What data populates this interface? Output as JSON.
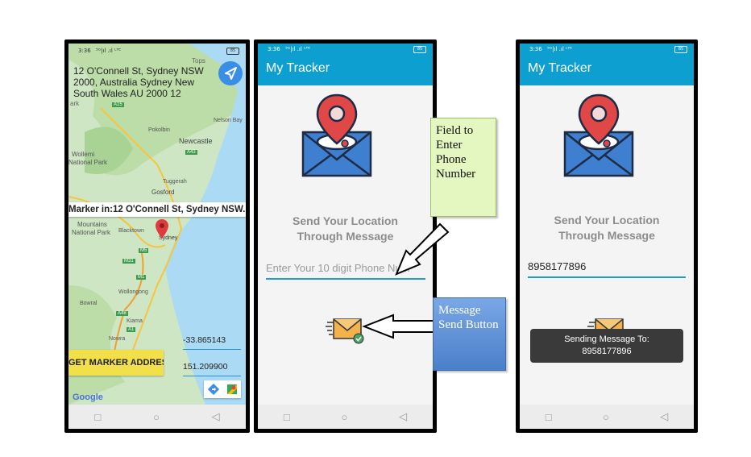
{
  "phone1": {
    "status_time": "3:36",
    "status_signal": "⁵ᴳ|ıl .ıl ᴸᵀᴱ",
    "battery": "85",
    "address": "12 O'Connell St, Sydney NSW 2000, Australia Sydney New South Wales AU 2000 12",
    "marker_info": "Marker in:12 O'Connell St, Sydney NSW...",
    "map_labels": [
      "Tops",
      "Park",
      "Nelson Bay",
      "Pokolbin",
      "Newcastle",
      "Wollemi",
      "National Park",
      "Tuggerah",
      "Gosford",
      "Mountains",
      "National Park",
      "Blacktown",
      "Sydney",
      "Wollongong",
      "Bowral",
      "Kiama",
      "Nowra",
      "A15",
      "A43",
      "M1",
      "M5",
      "M31",
      "A48",
      "A1",
      "ark"
    ],
    "latitude": "-33.865143",
    "longitude": "151.209900",
    "get_marker_button": "GET MARKER ADDRESS",
    "google_logo": "Google",
    "nav_icons": [
      "□",
      "○",
      "◁"
    ]
  },
  "phone2": {
    "status_time": "3:36",
    "status_signal": "⁵ᴳ|ıl .ıl ᴸᵀᴱ",
    "battery": "85",
    "app_title": "My Tracker",
    "heading_line1": "Send Your Location",
    "heading_line2": "Through Message",
    "phone_placeholder": "Enter Your 10 digit Phone Num",
    "nav_icons": [
      "□",
      "○",
      "◁"
    ]
  },
  "phone3": {
    "status_time": "3:36",
    "status_signal": "⁵ᴳ|ıl .ıl ᴸᵀᴱ",
    "battery": "85",
    "app_title": "My Tracker",
    "heading_line1": "Send Your Location",
    "heading_line2": "Through Message",
    "phone_value": "8958177896",
    "toast_line1": "Sending Message To:",
    "toast_line2": "8958177896",
    "nav_icons": [
      "□",
      "○",
      "◁"
    ]
  },
  "callouts": {
    "phone_field": "Field to Enter Phone Number",
    "send_button": "Message Send Button"
  },
  "colors": {
    "appbar": "#0d9fd0",
    "send_button_yellow": "#f2e04a",
    "callout_green": "#e4f7c0",
    "callout_blue": "#5b8ed6",
    "pin_red": "#e04848",
    "envelope_blue": "#3f7fcf"
  }
}
